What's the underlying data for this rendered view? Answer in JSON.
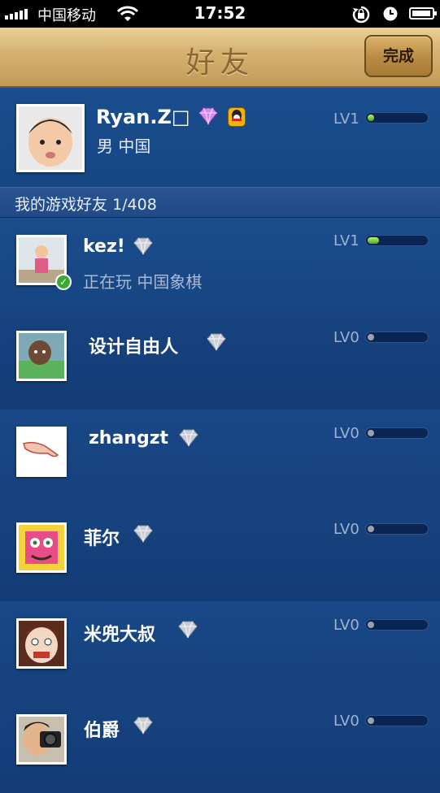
{
  "status_bar": {
    "carrier": "中国移动",
    "time": "17:52"
  },
  "header": {
    "title": "好友",
    "done_label": "完成"
  },
  "me": {
    "name": "Ryan.Z□",
    "info": "男 中国",
    "level": "LV1",
    "progress": 0.05
  },
  "section": {
    "label": "我的游戏好友",
    "count": "1/408"
  },
  "friends": [
    {
      "name": "kez!",
      "status": "正在玩 中国象棋",
      "level": "LV1",
      "progress": 0.2,
      "online": true
    },
    {
      "name": "设计自由人",
      "level": "LV0",
      "progress": 0
    },
    {
      "name": "zhangzt",
      "level": "LV0",
      "progress": 0
    },
    {
      "name": "菲尔",
      "level": "LV0",
      "progress": 0
    },
    {
      "name": "米兜大叔",
      "level": "LV0",
      "progress": 0
    },
    {
      "name": "伯爵",
      "level": "LV0",
      "progress": 0
    }
  ],
  "colors": {
    "background": "#123e7e",
    "titlebar": "#d6b373",
    "progress_green": "#4cae16"
  },
  "icons": [
    "signal-icon",
    "wifi-icon",
    "rotation-lock-icon",
    "alarm-icon",
    "battery-icon",
    "diamond-icon",
    "qq-icon",
    "online-check-icon"
  ]
}
